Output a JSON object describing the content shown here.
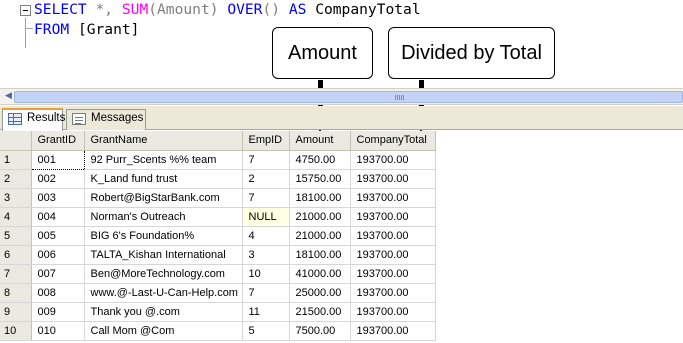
{
  "editor": {
    "line1": {
      "select_kw": "SELECT",
      "star": " *, ",
      "sum_fn": "SUM",
      "args": "(Amount) ",
      "over_kw": "OVER",
      "parens": "() ",
      "as_kw": "AS",
      "alias": " CompanyTotal"
    },
    "line2": {
      "from_kw": "FROM",
      "table": " [Grant]"
    },
    "colors": {
      "keyword": "#0000ff",
      "function": "#ff00ff",
      "operator": "#808080"
    }
  },
  "callouts": {
    "amount": "Amount",
    "divided": "Divided by Total"
  },
  "tabs": {
    "results": "Results",
    "messages": "Messages",
    "active_accent": "#e8a03a"
  },
  "grid": {
    "columns": [
      "",
      "GrantID",
      "GrantName",
      "EmpID",
      "Amount",
      "CompanyTotal"
    ],
    "rows": [
      [
        "1",
        "001",
        "92 Purr_Scents %% team",
        "7",
        "4750.00",
        "193700.00"
      ],
      [
        "2",
        "002",
        "K_Land fund trust",
        "2",
        "15750.00",
        "193700.00"
      ],
      [
        "3",
        "003",
        "Robert@BigStarBank.com",
        "7",
        "18100.00",
        "193700.00"
      ],
      [
        "4",
        "004",
        "Norman's Outreach",
        "NULL",
        "21000.00",
        "193700.00"
      ],
      [
        "5",
        "005",
        "BIG 6's Foundation%",
        "4",
        "21000.00",
        "193700.00"
      ],
      [
        "6",
        "006",
        "TALTA_Kishan International",
        "3",
        "18100.00",
        "193700.00"
      ],
      [
        "7",
        "007",
        "Ben@MoreTechnology.com",
        "10",
        "41000.00",
        "193700.00"
      ],
      [
        "8",
        "008",
        "www.@-Last-U-Can-Help.com",
        "7",
        "25000.00",
        "193700.00"
      ],
      [
        "9",
        "009",
        "Thank you @.com",
        "11",
        "21500.00",
        "193700.00"
      ],
      [
        "10",
        "010",
        "Call Mom @Com",
        "5",
        "7500.00",
        "193700.00"
      ]
    ],
    "null_highlight": "#ffffe1"
  }
}
